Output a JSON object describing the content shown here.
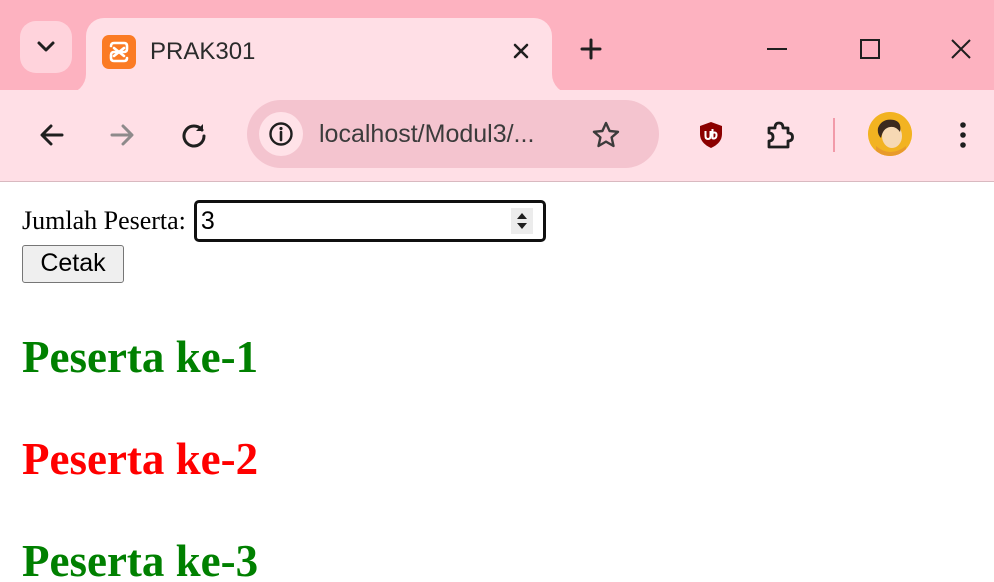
{
  "tab": {
    "title": "PRAK301",
    "favicon": "xampp-icon"
  },
  "omnibox": {
    "url": "localhost/Modul3/..."
  },
  "colors": {
    "tab_strip": "#fdb2c0",
    "toolbar": "#ffdfe6",
    "green": "#008000",
    "red": "#ff0000"
  },
  "form": {
    "label": "Jumlah Peserta:",
    "value": "3",
    "button_label": "Cetak"
  },
  "results": [
    {
      "text": "Peserta ke-1",
      "color": "#008000"
    },
    {
      "text": "Peserta ke-2",
      "color": "#ff0000"
    },
    {
      "text": "Peserta ke-3",
      "color": "#008000"
    }
  ]
}
